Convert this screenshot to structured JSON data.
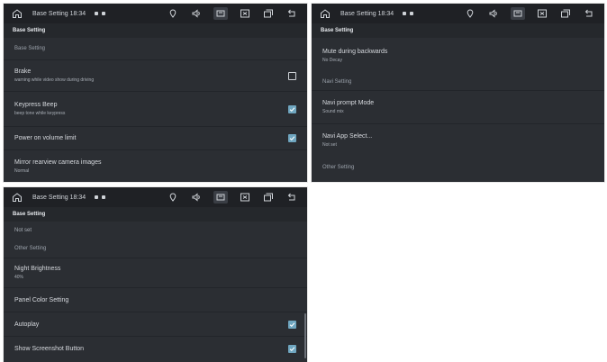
{
  "panels": [
    {
      "statusbar": {
        "title": "Base Setting",
        "time": "18:34"
      },
      "header": "Base Setting",
      "section": "Base Setting",
      "rows": [
        {
          "title": "Brake",
          "sub": "warning while video show during driving",
          "checkbox": "unchecked"
        },
        {
          "title": "Keypress Beep",
          "sub": "beep tone while keypress",
          "checkbox": "checked"
        },
        {
          "title": "Power on volume limit",
          "sub": "",
          "checkbox": "checked"
        },
        {
          "title": "Mirror rearview camera images",
          "sub": "Normal",
          "checkbox": "none"
        }
      ]
    },
    {
      "statusbar": {
        "title": "Base Setting",
        "time": "18:34"
      },
      "header": "Base Setting",
      "rows_top": [
        {
          "title": "Mute during backwards",
          "sub": "No Decay"
        }
      ],
      "section": "Navi Setting",
      "rows": [
        {
          "title": "Navi prompt Mode",
          "sub": "Sound mix"
        },
        {
          "title": "Navi App Select...",
          "sub": "Not set"
        }
      ],
      "section2": "Other Setting"
    },
    {
      "statusbar": {
        "title": "Base Setting",
        "time": "18:34"
      },
      "header": "Base Setting",
      "rows_top": [
        {
          "title": "Not set",
          "sub": ""
        }
      ],
      "section": "Other Setting",
      "rows": [
        {
          "title": "Night Brightness",
          "sub": "40%",
          "checkbox": "none"
        },
        {
          "title": "Panel Color Setting",
          "sub": "",
          "checkbox": "none"
        },
        {
          "title": "Autoplay",
          "sub": "",
          "checkbox": "checked"
        },
        {
          "title": "Show Screenshot Button",
          "sub": "",
          "checkbox": "checked"
        }
      ]
    }
  ],
  "colors": {
    "panel_bg": "#2b2e33",
    "statusbar_bg": "#1f2125",
    "header_bg": "#25282c",
    "checkbox_checked": "#6fa6c0"
  },
  "icons": {
    "home": "home-icon",
    "location": "location-pin-icon",
    "volume": "volume-icon",
    "apps": "apps-icon",
    "close": "close-box-icon",
    "windows": "recent-windows-icon",
    "back": "back-icon",
    "check": "check-icon"
  }
}
